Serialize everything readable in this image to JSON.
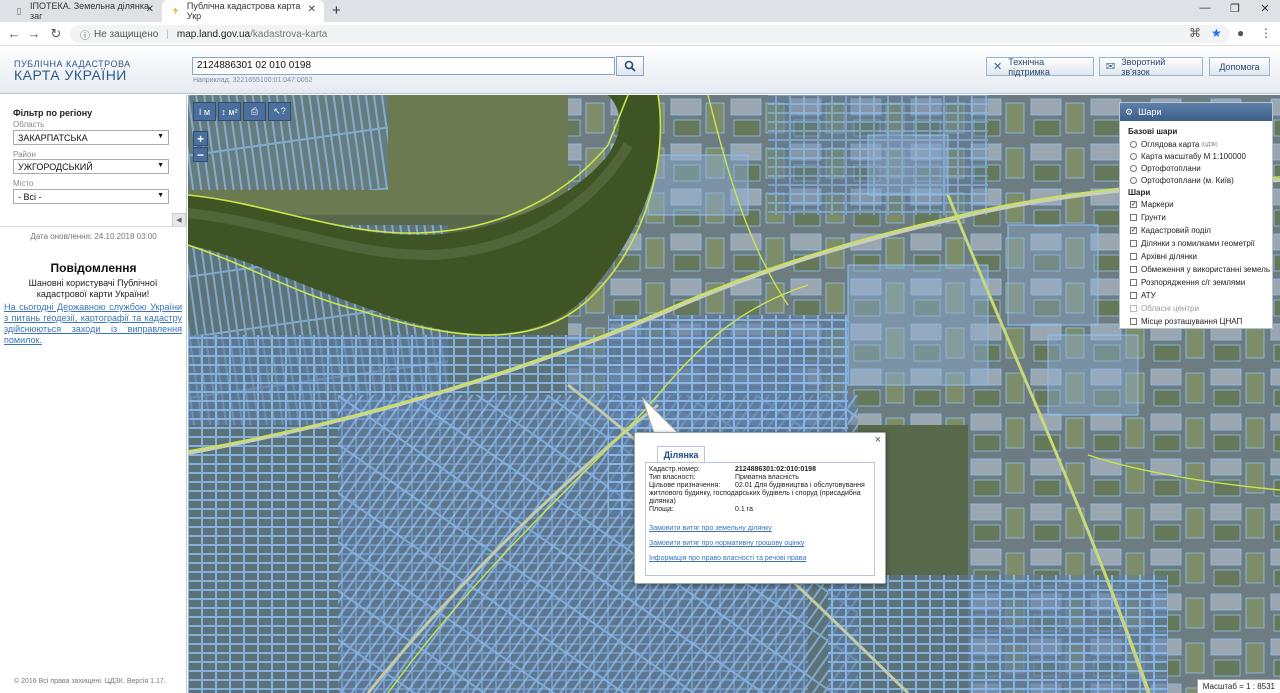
{
  "browser": {
    "tabs": [
      {
        "title": "ІПОТЕКА. Земельна ділянка, заг",
        "close": "✕"
      },
      {
        "title": "Публічна кадастрова карта Укр",
        "close": "✕"
      }
    ],
    "new_tab": "+",
    "window_controls": [
      "—",
      "❐",
      "✕"
    ],
    "security_label": "Не защищено",
    "url_domain": "map.land.gov.ua",
    "url_path": "/kadastrova-karta"
  },
  "header": {
    "logo_line1": "ПУБЛІЧНА КАДАСТРОВА",
    "logo_line2": "КАРТА УКРАЇНИ",
    "search_value": "2124886301 02 010 0198",
    "search_example": "Наприклад: 3221655100:01:047:0052",
    "buttons": {
      "support": "Технічна підтримка",
      "feedback": "Зворотний зв'язок",
      "help": "Допомога"
    }
  },
  "filter": {
    "title": "Фільтр по регіону",
    "region_label": "Область",
    "region_value": "ЗАКАРПАТСЬКА",
    "district_label": "Район",
    "district_value": "УЖГОРОДСЬКИЙ",
    "city_label": "Місто",
    "city_value": "- Всі -",
    "updated": "Дата оновлення: 24.10.2018 03:00"
  },
  "notice": {
    "title": "Повідомлення",
    "text": "Шановні користувачі Публічної кадастрової карти України!",
    "link": "На сьогодні Державною службою України з питань геодезії, картографії та кадастру здійснюються заходи із виправлення помилок."
  },
  "footer": {
    "copyright": "© 2016 Всі права захищені. ЦДЗК. Версія 1.17."
  },
  "map_tools": [
    "І м",
    "↕ м²",
    "⎙",
    "↖?"
  ],
  "zoom": {
    "in": "+",
    "out": "−"
  },
  "layers": {
    "title": "Шари",
    "base_title": "Базові шари",
    "base": [
      {
        "label": "Оглядова карта",
        "sup": "(ЦДЗК)"
      },
      {
        "label": "Карта масштабу М 1:100000",
        "sup": ""
      },
      {
        "label": "Ортофотоплани",
        "sup": ""
      },
      {
        "label": "Ортофотоплани (м. Київ)",
        "sup": ""
      }
    ],
    "overlay_title": "Шари",
    "overlays": [
      {
        "label": "Маркери",
        "checked": true,
        "disabled": false
      },
      {
        "label": "Грунти",
        "checked": false,
        "disabled": false
      },
      {
        "label": "Кадастровий поділ",
        "checked": true,
        "disabled": false
      },
      {
        "label": "Ділянки з помилками геометрії",
        "checked": false,
        "disabled": false
      },
      {
        "label": "Архівні ділянки",
        "checked": false,
        "disabled": false
      },
      {
        "label": "Обмеження у використанні земель",
        "checked": false,
        "disabled": false
      },
      {
        "label": "Розпорядження с/г землями",
        "checked": false,
        "disabled": false
      },
      {
        "label": "АТУ",
        "checked": false,
        "disabled": false
      },
      {
        "label": "Обласні центри",
        "checked": false,
        "disabled": true
      },
      {
        "label": "Місце розташування ЦНАП",
        "checked": false,
        "disabled": false
      }
    ]
  },
  "popup": {
    "tab": "Ділянка",
    "close": "×",
    "rows": [
      {
        "key": "Кадастр.номер:",
        "value": "2124886301:02:010:0198"
      },
      {
        "key": "Тип власності:",
        "value": "Приватна власність"
      },
      {
        "key": "Цільове призначення:",
        "value": "02.01 Для будівництва і обслуговування житлового будинку, господарських будівель і споруд (присадибна ділянка)"
      },
      {
        "key": "Площа:",
        "value": "0.1 га"
      }
    ],
    "links": [
      "Замовити витяг про земельну ділянку",
      "Замовити витяг про нормативну грошову оцінку",
      "Інформація про право власності та речові права"
    ]
  },
  "scale": "Масштаб = 1 : 8531",
  "colors": {
    "brand": "#2c5a8c",
    "parcel": "#6ea8e6",
    "boundary": "#c9e64a",
    "river": "#4f6b2a"
  }
}
